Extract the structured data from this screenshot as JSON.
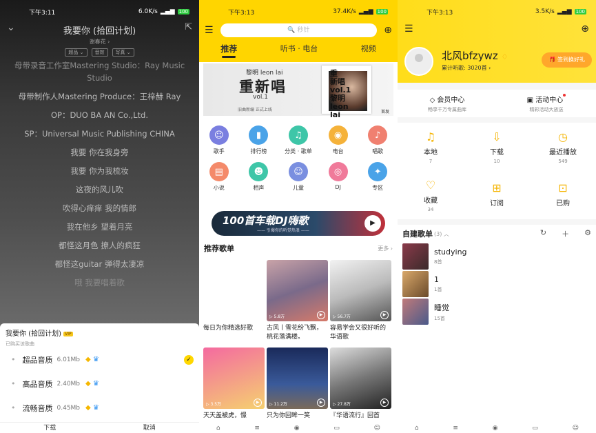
{
  "player": {
    "status": {
      "time": "下午3:11",
      "speed": "6.0K/s",
      "battery": "100"
    },
    "song_title": "我要你 (拾回计划)",
    "artist": "谢春花 ›",
    "tags": [
      "超品 ⌄",
      "音效",
      "写真 ⌄"
    ],
    "lyrics": [
      "母带录音工作室Mastering Studio：Ray Music Studio",
      "母带制作人Mastering Produce：王梓赫 Ray",
      "OP：DUO BA AN Co.,Ltd.",
      "SP：Universal Music Publishing CHINA",
      "我要 你在我身旁",
      "我要 你为我梳妆",
      "这夜的风儿吹",
      "吹得心痒痒 我的情郎",
      "我在他乡 望着月亮",
      "都怪这月色 撩人的疯狂",
      "都怪这guitar 弹得太凄凉",
      "哦 我要唱着歌"
    ],
    "sheet": {
      "title": "我要你 (拾回计划)",
      "badge": "VIP",
      "subtitle": "已购买该歌曲",
      "qualities": [
        {
          "name": "超品音质",
          "size": "6.01Mb",
          "selected": true
        },
        {
          "name": "高品音质",
          "size": "2.40Mb",
          "selected": false
        },
        {
          "name": "流畅音质",
          "size": "0.45Mb",
          "selected": false
        }
      ],
      "buttons": [
        "下载",
        "取消"
      ]
    }
  },
  "home": {
    "status": {
      "time": "下午3:13",
      "speed": "37.4K/s",
      "battery": "100"
    },
    "search_placeholder": "🔍 秒针",
    "tabs": [
      "推荐",
      "听书 · 电台",
      "视频"
    ],
    "banner": {
      "artist": "黎明 leon lai",
      "title": "重新唱",
      "vol": "vol.1",
      "sub": "旧曲新编  正式上线",
      "pic_text": "重\n新唱\nvol.1\n黎明\nleon\nlai",
      "tag": "首发"
    },
    "categories": [
      {
        "label": "歌手",
        "color": "#7a7fe0",
        "icon": "singer-icon",
        "glyph": "☺"
      },
      {
        "label": "排行榜",
        "color": "#4aa3e8",
        "icon": "chart-icon",
        "glyph": "▮"
      },
      {
        "label": "分类 · 歌单",
        "color": "#3ec6a8",
        "icon": "playlist-icon",
        "glyph": "♫"
      },
      {
        "label": "电台",
        "color": "#f5b23a",
        "icon": "radio-icon",
        "glyph": "◉"
      },
      {
        "label": "唱歌",
        "color": "#f08070",
        "icon": "mic-icon",
        "glyph": "♪"
      },
      {
        "label": "小说",
        "color": "#f48a6a",
        "icon": "novel-icon",
        "glyph": "▤"
      },
      {
        "label": "相声",
        "color": "#3ec6a8",
        "icon": "crosstalk-icon",
        "glyph": "☻"
      },
      {
        "label": "儿童",
        "color": "#7a8fe0",
        "icon": "kids-icon",
        "glyph": "☺"
      },
      {
        "label": "DJ",
        "color": "#f07a9a",
        "icon": "dj-icon",
        "glyph": "◎"
      },
      {
        "label": "专区",
        "color": "#4aa3e8",
        "icon": "zone-icon",
        "glyph": "✦"
      }
    ],
    "dj_banner": {
      "title": "100首车载DJ嗨歌",
      "sub": "—— 引爆你的听觉热浪 ——"
    },
    "section_title": "推荐歌单",
    "section_more": "更多 ›",
    "cards": [
      {
        "title": "每日为你精选好歌",
        "count": "",
        "bg": "#ffffff"
      },
      {
        "title": "古风丨雪花纷飞飘，桃花落满楼。",
        "count": "▷ 5.8万",
        "bg": "linear-gradient(160deg,#c9a3a8,#7a6a8a 50%,#d67a6a)"
      },
      {
        "title": "容易学会又很好听的华语歌",
        "count": "▷ 56.7万",
        "bg": "linear-gradient(160deg,#f2f2f2,#bbb 50%,#555)"
      },
      {
        "title": "天天盖被虎，憬",
        "count": "▷ 3.5万",
        "bg": "linear-gradient(160deg,#f46aa0,#f5d070)"
      },
      {
        "title": "只为你回眸一笑",
        "count": "▷ 11.2万",
        "bg": "linear-gradient(180deg,#1a2a5a,#3a5a9a 60%,#7a6a5a)"
      },
      {
        "title": "『华语流行』回首",
        "count": "▷ 27.8万",
        "bg": "linear-gradient(160deg,#ddd,#777 50%,#222)"
      }
    ]
  },
  "mine": {
    "status": {
      "time": "下午3:13",
      "speed": "3.5K/s",
      "battery": "100"
    },
    "username": "北风bfzywz",
    "listen": "累计听歌: 3020首 ›",
    "sign_btn": "🎁 签到换好礼",
    "centers": [
      {
        "title": "◇ 会员中心",
        "sub": "畅享千万专属曲库"
      },
      {
        "title": "▣ 活动中心",
        "sub": "精彩活动大放送"
      }
    ],
    "shortcuts": [
      {
        "icon": "♫",
        "name": "music-icon",
        "label": "本地",
        "count": "7"
      },
      {
        "icon": "⇩",
        "name": "download-icon",
        "label": "下载",
        "count": "10"
      },
      {
        "icon": "◷",
        "name": "clock-icon",
        "label": "最近播放",
        "count": "549"
      },
      {
        "icon": "♡",
        "name": "heart-icon",
        "label": "收藏",
        "count": "34"
      },
      {
        "icon": "⊞",
        "name": "subscribe-icon",
        "label": "订阅",
        "count": ""
      },
      {
        "icon": "⊡",
        "name": "purchased-icon",
        "label": "已购",
        "count": ""
      }
    ],
    "my_title": "自建歌单",
    "my_count": "(3) ︿",
    "playlists": [
      {
        "name": "studying",
        "count": "8首",
        "bg": "linear-gradient(135deg,#8a3a4a,#3a2a2a)"
      },
      {
        "name": "1",
        "count": "1首",
        "bg": "linear-gradient(135deg,#d9a86a,#6a4a2a)"
      },
      {
        "name": "睡觉",
        "count": "15首",
        "bg": "linear-gradient(135deg,#c07a7a,#4a5a8a)"
      }
    ]
  }
}
